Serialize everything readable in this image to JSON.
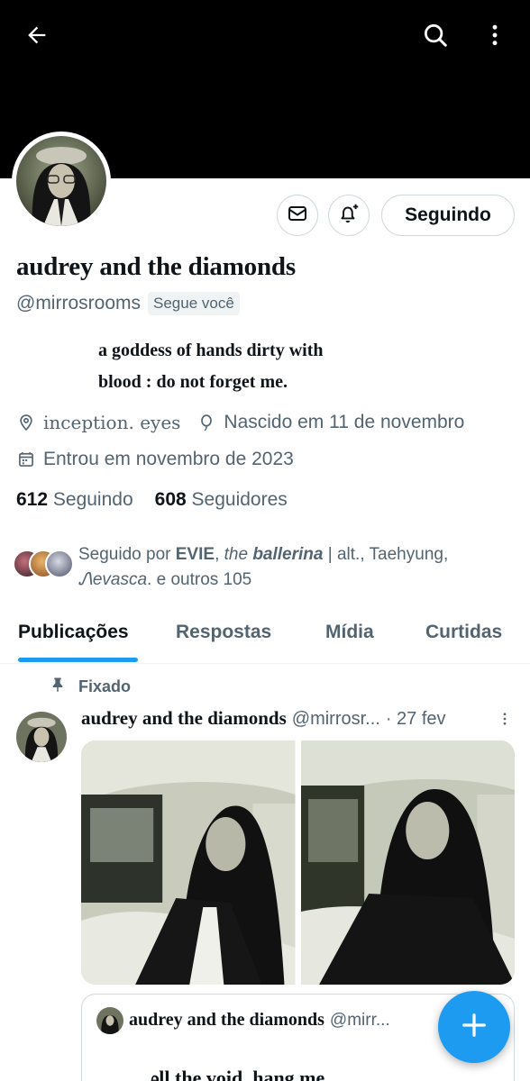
{
  "header": {
    "back_icon": "arrow-left-icon",
    "search_icon": "search-icon",
    "more_icon": "more-vertical-icon"
  },
  "profile": {
    "display_name": "audrey and the diamonds",
    "handle": "@mirrosrooms",
    "follows_you_badge": "Segue você",
    "bio": "a goddess ᴏf hands dirty with\nblood : do not forget me.",
    "location": "inceptіon.  eyes",
    "birthday": "Nascido em 11 de novembro",
    "joined": "Entrou em novembro de 2023",
    "following_count": "612",
    "following_label": "Seguindo",
    "followers_count": "608",
    "followers_label": "Seguidores"
  },
  "actions": {
    "message_icon": "mail-icon",
    "notify_icon": "bell-plus-icon",
    "follow_button": "Seguindo"
  },
  "followed_by": {
    "prefix": "Seguido por ",
    "name1": "EVIE",
    "sep1": ", ",
    "name2_italic": "the ",
    "name2_bold_italic": "ballerina",
    "name2_rest": " | alt.",
    "sep2": ", ",
    "name3": "Taehyung",
    "sep3": ", ",
    "name4": "Ꮑevasca",
    "suffix": ". e outros 105"
  },
  "tabs": [
    {
      "label": "Publicações",
      "active": true
    },
    {
      "label": "Respostas",
      "active": false
    },
    {
      "label": "Mídia",
      "active": false
    },
    {
      "label": "Curtidas",
      "active": false
    }
  ],
  "pinned_post": {
    "pinned_label": "Fixado",
    "author_name": "audrey and the diamonds",
    "author_handle": "@mirrosr...",
    "time": "· 27 fev",
    "quote": {
      "author_name": "audrey and the diamonds",
      "author_handle": "@mirr...",
      "text": "ꭿll the void, hang me"
    }
  },
  "fab": {
    "icon": "plus-icon"
  },
  "colors": {
    "accent": "#1d9bf0",
    "secondary_text": "#536471",
    "primary_text": "#0f1419",
    "border": "#cfd9de",
    "banner": "#000000"
  }
}
